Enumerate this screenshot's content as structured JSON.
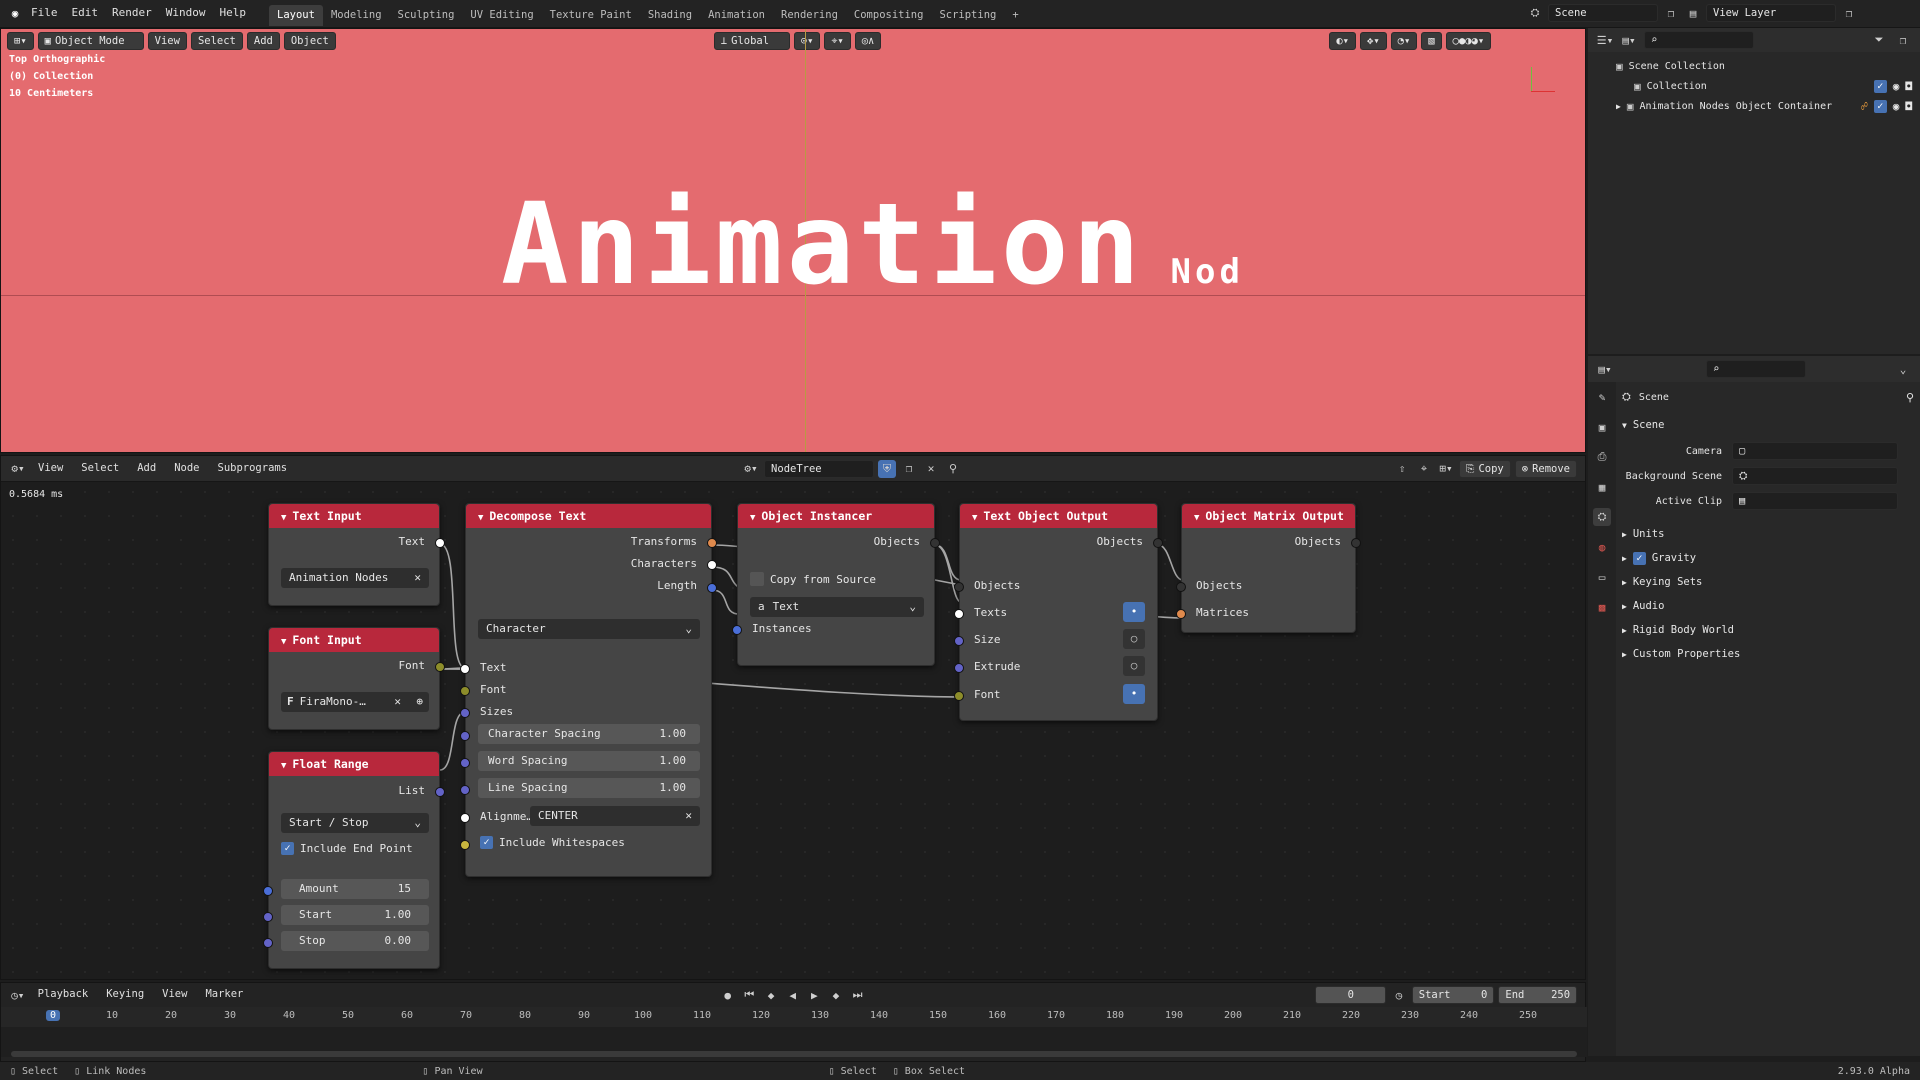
{
  "topbar": {
    "menus": [
      "File",
      "Edit",
      "Render",
      "Window",
      "Help"
    ],
    "workspaces": [
      "Layout",
      "Modeling",
      "Sculpting",
      "UV Editing",
      "Texture Paint",
      "Shading",
      "Animation",
      "Rendering",
      "Compositing",
      "Scripting"
    ],
    "add_tab": "+",
    "scene_label": "Scene",
    "view_layer_label": "View Layer"
  },
  "viewport": {
    "mode": "Object Mode",
    "view": "View",
    "select": "Select",
    "add": "Add",
    "object": "Object",
    "orientation": "Global",
    "overlay_view": "Top Orthographic",
    "overlay_collection": "(0) Collection",
    "overlay_scale": "10 Centimeters",
    "big_text": "Animation",
    "small_text": "Nod",
    "bg_color": "#e46b6f"
  },
  "outliner": {
    "root": "Scene Collection",
    "items": [
      "Collection",
      "Animation Nodes Object Container"
    ]
  },
  "properties": {
    "title": "Scene",
    "section": "Scene",
    "camera_label": "Camera",
    "bg_scene_label": "Background Scene",
    "active_clip_label": "Active Clip",
    "panels": [
      "Units",
      "Gravity",
      "Keying Sets",
      "Audio",
      "Rigid Body World",
      "Custom Properties"
    ]
  },
  "node_editor": {
    "menus": [
      "View",
      "Select",
      "Add",
      "Node",
      "Subprograms"
    ],
    "tree_name": "NodeTree",
    "copy_label": "Copy",
    "remove_label": "Remove",
    "exec_time": "0.5684 ms",
    "nodes": {
      "text_input": {
        "title": "Text Input",
        "out": "Text",
        "value": "Animation Nodes"
      },
      "font_input": {
        "title": "Font Input",
        "out": "Font",
        "value": "FiraMono-…"
      },
      "float_range": {
        "title": "Float Range",
        "out": "List",
        "mode": "Start / Stop",
        "include_end": "Include End Point",
        "amount_label": "Amount",
        "amount": "15",
        "start_label": "Start",
        "start": "1.00",
        "stop_label": "Stop",
        "stop": "0.00"
      },
      "decompose": {
        "title": "Decompose Text",
        "outs": [
          "Transforms",
          "Characters",
          "Length"
        ],
        "mode": "Character",
        "ins": [
          "Text",
          "Font",
          "Sizes"
        ],
        "char_spacing_label": "Character Spacing",
        "char_spacing": "1.00",
        "word_spacing_label": "Word Spacing",
        "word_spacing": "1.00",
        "line_spacing_label": "Line Spacing",
        "line_spacing": "1.00",
        "align_label": "Alignme…",
        "align": "CENTER",
        "whitespace": "Include Whitespaces"
      },
      "instancer": {
        "title": "Object Instancer",
        "out": "Objects",
        "copy": "Copy from Source",
        "type": "Text",
        "in": "Instances"
      },
      "text_output": {
        "title": "Text Object Output",
        "out": "Objects",
        "ins": [
          "Objects",
          "Texts",
          "Size",
          "Extrude",
          "Font"
        ]
      },
      "matrix_output": {
        "title": "Object Matrix Output",
        "out": "Objects",
        "ins": [
          "Objects",
          "Matrices"
        ]
      }
    }
  },
  "timeline": {
    "menus": [
      "Playback",
      "Keying",
      "View",
      "Marker"
    ],
    "current": "0",
    "start_label": "Start",
    "start": "0",
    "end_label": "End",
    "end": "250",
    "ticks": [
      "0",
      "10",
      "20",
      "30",
      "40",
      "50",
      "60",
      "70",
      "80",
      "90",
      "100",
      "110",
      "120",
      "130",
      "140",
      "150",
      "160",
      "170",
      "180",
      "190",
      "200",
      "210",
      "220",
      "230",
      "240",
      "250"
    ]
  },
  "statusbar": {
    "select": "Select",
    "link": "Link Nodes",
    "pan": "Pan View",
    "select2": "Select",
    "box": "Box Select",
    "version": "2.93.0 Alpha"
  }
}
